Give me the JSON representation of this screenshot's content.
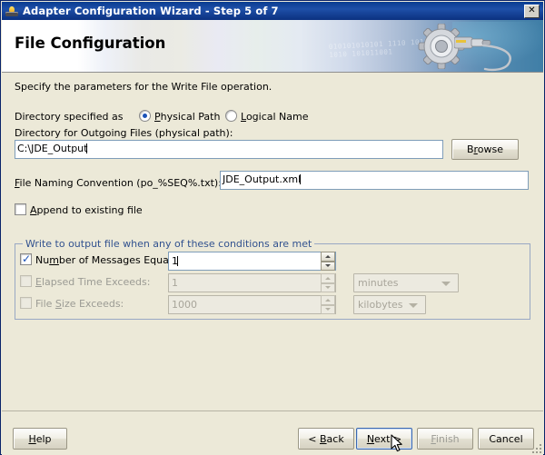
{
  "window": {
    "title": "Adapter Configuration Wizard - Step 5 of 7",
    "icon": "wizard-lamp-icon",
    "close_label": "✕"
  },
  "banner": {
    "title": "File Configuration",
    "decor_binary_line1": "010101010101 1110  10101",
    "decor_binary_line2": "1010 101011001",
    "gear_icon": "gear-connector-icon"
  },
  "main": {
    "instruction": "Specify the parameters for the Write File operation.",
    "directory_specified_label": "Directory specified as",
    "radios": [
      {
        "label": "Physical Path",
        "mnemonic": "P",
        "selected": true
      },
      {
        "label": "Logical Name",
        "mnemonic": "L",
        "selected": false
      }
    ],
    "outgoing_dir_label": "Directory for Outgoing Files (physical path):",
    "outgoing_dir_value": "C:\\JDE_Output",
    "browse_label": "Browse",
    "browse_mnemonic": "r",
    "naming_label": "File Naming Convention (po_%SEQ%.txt):",
    "naming_mnemonic": "F",
    "naming_value": "JDE_Output.xml",
    "append_label": "Append to existing file",
    "append_mnemonic": "A",
    "append_checked": false
  },
  "conditions_group": {
    "title": "Write to output file when any of these conditions are met",
    "rows": [
      {
        "label": "Number of Messages Equals:",
        "mnemonic": "m",
        "checked": true,
        "enabled": true,
        "value": "1",
        "unit": null
      },
      {
        "label": "Elapsed Time Exceeds:",
        "mnemonic": "E",
        "checked": false,
        "enabled": false,
        "value": "1",
        "unit": "minutes"
      },
      {
        "label": "File Size Exceeds:",
        "mnemonic": "S",
        "checked": false,
        "enabled": false,
        "value": "1000",
        "unit": "kilobytes"
      }
    ]
  },
  "footer": {
    "help_label": "Help",
    "back_label": "< Back",
    "next_label": "Next >",
    "finish_label": "Finish",
    "cancel_label": "Cancel",
    "finish_enabled": false,
    "next_focused": true
  },
  "colors": {
    "titlebar_blue": "#0a3d91",
    "dialog_face": "#ece9d8",
    "group_title": "#32528f",
    "accent_blue": "#1b52b8",
    "disabled_text": "#9b9b94"
  }
}
